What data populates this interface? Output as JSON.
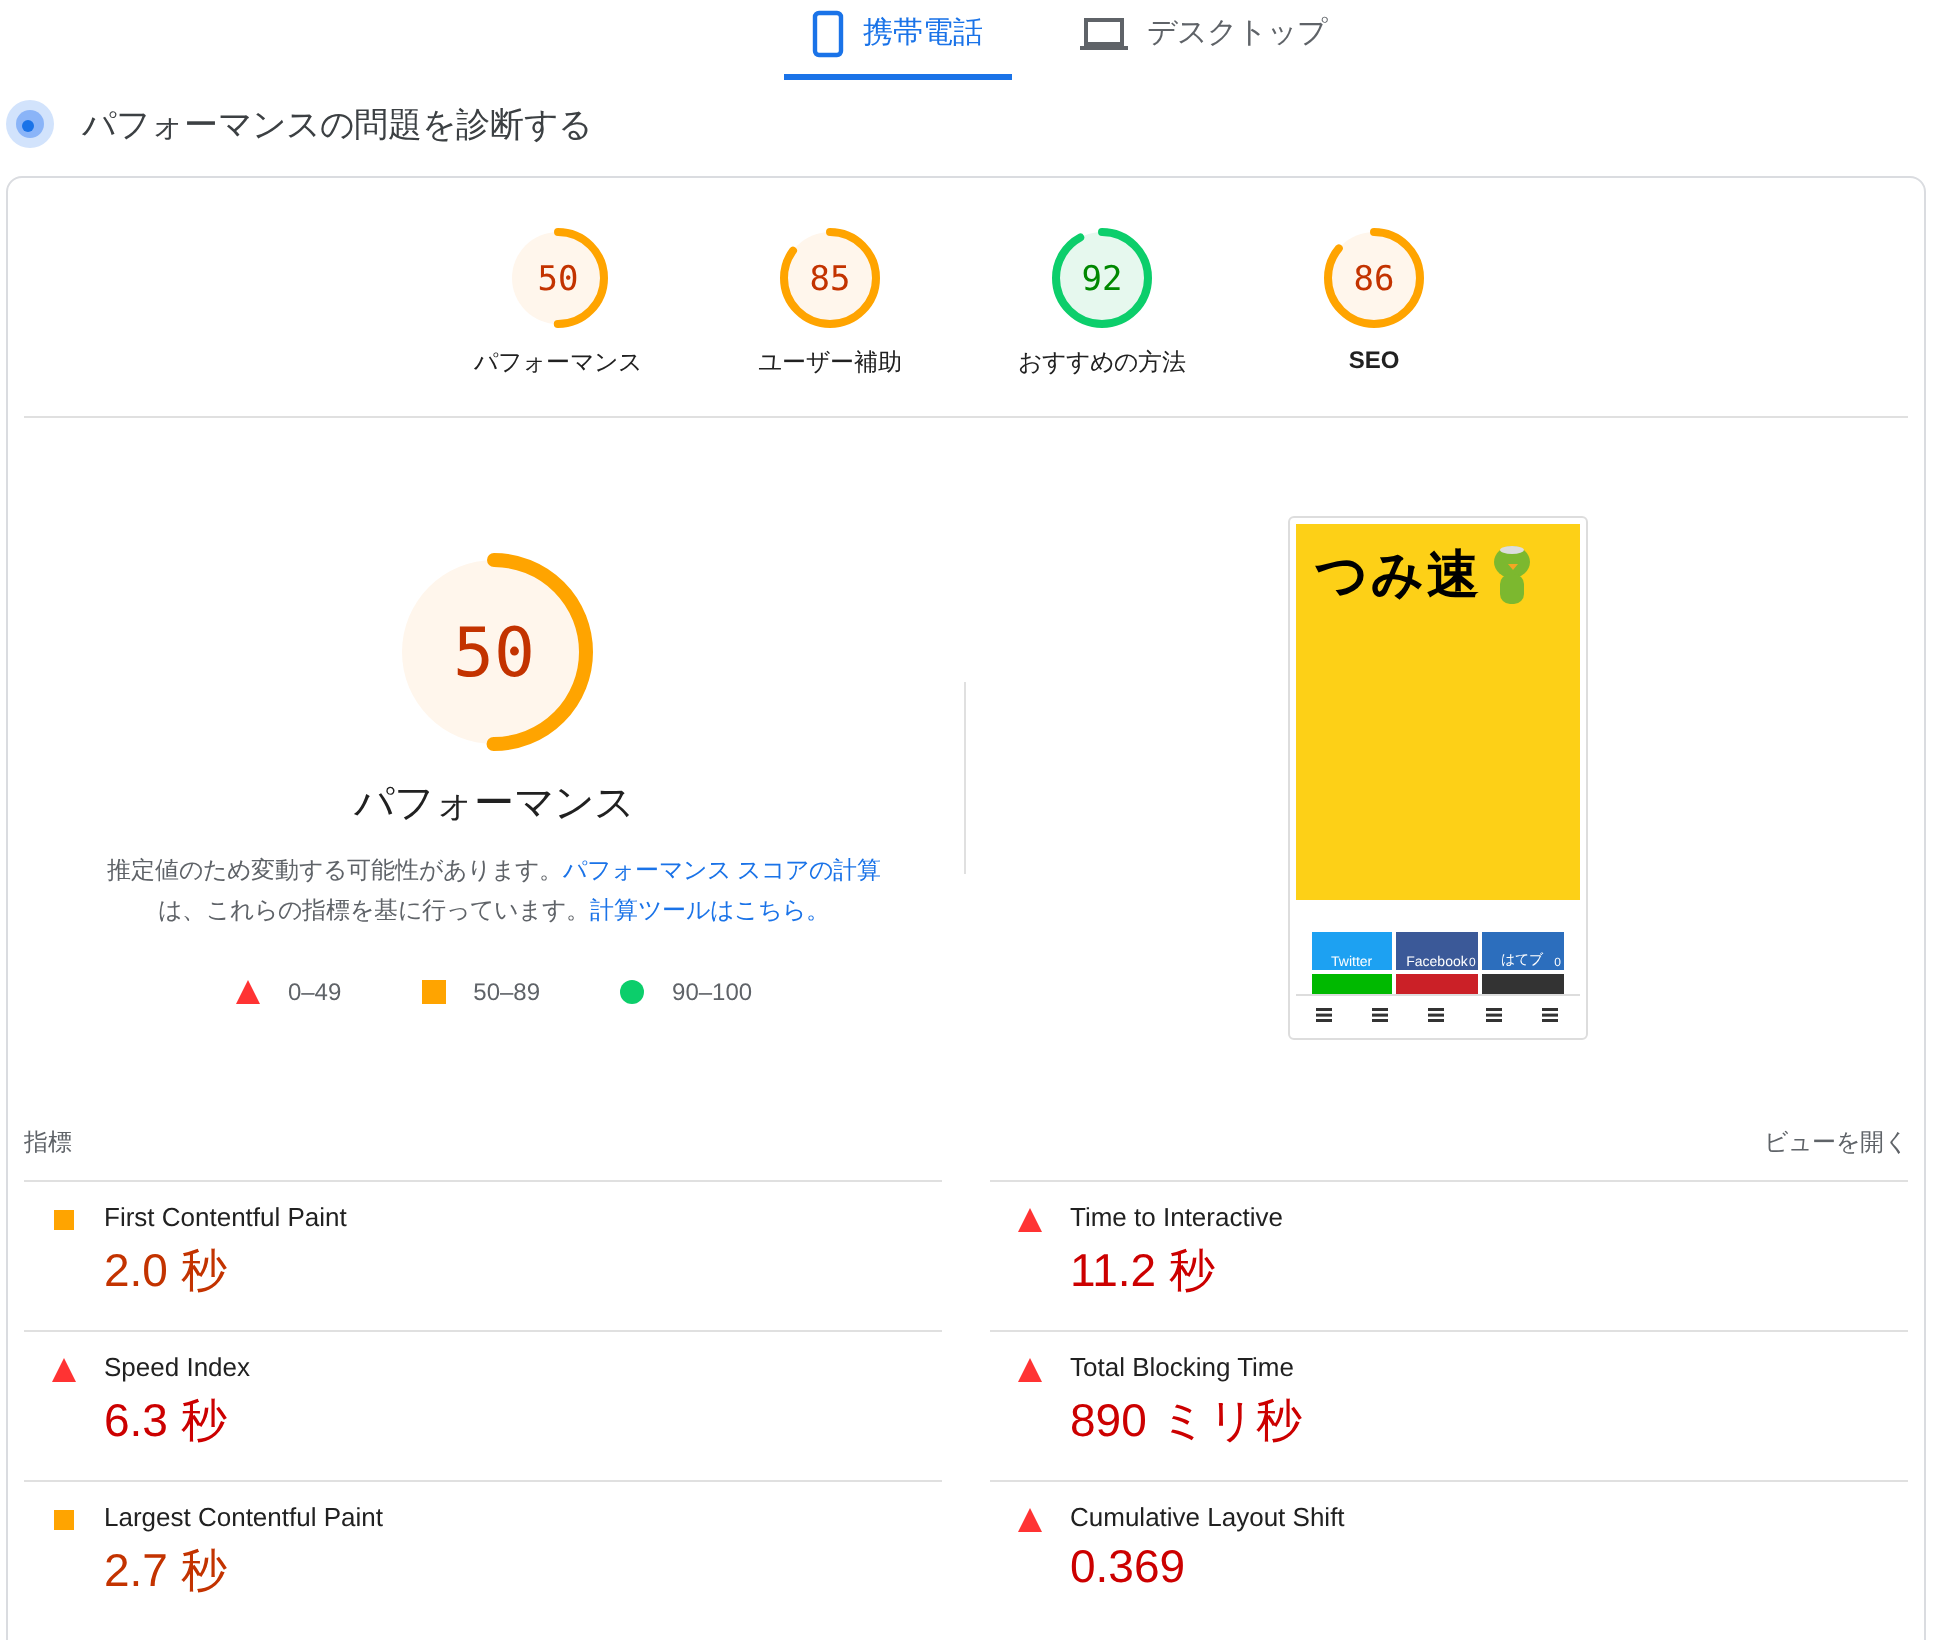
{
  "device_tabs": [
    {
      "label": "携帯電話",
      "kind": "phone",
      "selected": true
    },
    {
      "label": "デスクトップ",
      "kind": "desktop",
      "selected": false
    }
  ],
  "heading": "パフォーマンスの問題を診断する",
  "category_scores": [
    {
      "score": "50",
      "label": "パフォーマンス",
      "kind": "average",
      "level": 0.5
    },
    {
      "score": "85",
      "label": "ユーザー補助",
      "kind": "average",
      "level": 0.85
    },
    {
      "score": "92",
      "label": "おすすめの方法",
      "kind": "pass",
      "level": 0.92
    },
    {
      "score": "86",
      "label": "SEO",
      "kind": "average",
      "level": 0.86
    }
  ],
  "main_score": {
    "score": "50",
    "label": "パフォーマンス",
    "kind": "average",
    "level": 0.5,
    "description": "推定値のため変動する可能性があります。",
    "link_1": "パフォーマンス スコアの計算",
    "description_2": "は、これらの指標を基に行っています。",
    "link_2": "計算ツールはこちら。"
  },
  "legend": [
    {
      "range": "0–49",
      "kind": "fail"
    },
    {
      "range": "50–89",
      "kind": "average"
    },
    {
      "range": "90–100",
      "kind": "pass"
    }
  ],
  "page_screenshot": {
    "logo": "つみ速",
    "share_buttons": [
      {
        "label": "Twitter",
        "color": "#1da1f2"
      },
      {
        "label": "Facebook",
        "count": "0",
        "color": "#3b5998"
      },
      {
        "label": "はてブ",
        "count": "0",
        "color": "#2c6ebd"
      },
      {
        "color": "#00b900"
      },
      {
        "color": "#cb2027"
      },
      {
        "color": "#333333"
      }
    ]
  },
  "metrics_header": {
    "title": "指標",
    "toggle": "ビューを開く"
  },
  "metrics": [
    {
      "name": "First Contentful Paint",
      "value": "2.0 秒",
      "kind": "average"
    },
    {
      "name": "Time to Interactive",
      "value": "11.2 秒",
      "kind": "fail"
    },
    {
      "name": "Speed Index",
      "value": "6.3 秒",
      "kind": "fail"
    },
    {
      "name": "Total Blocking Time",
      "value": "890 ミリ秒",
      "kind": "fail"
    },
    {
      "name": "Largest Contentful Paint",
      "value": "2.7 秒",
      "kind": "average"
    },
    {
      "name": "Cumulative Layout Shift",
      "value": "0.369",
      "kind": "fail"
    }
  ]
}
